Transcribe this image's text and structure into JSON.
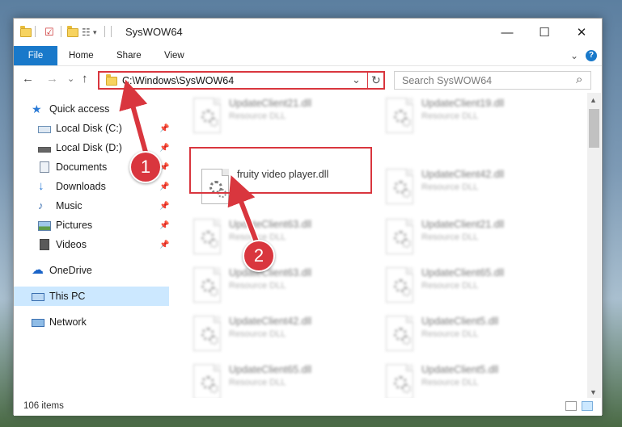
{
  "window": {
    "title": "SysWOW64",
    "controls": {
      "minimize": "—",
      "maximize": "☐",
      "close": "✕"
    }
  },
  "ribbon": {
    "tabs": [
      "File",
      "Home",
      "Share",
      "View"
    ],
    "expand": "⌄",
    "help": "?"
  },
  "nav": {
    "back": "←",
    "forward": "→",
    "recent": "⌄",
    "up": "↑",
    "address": "C:\\Windows\\SysWOW64",
    "dropdown": "⌄",
    "refresh": "↻",
    "search_placeholder": "Search SysWOW64",
    "search_icon": "⌕"
  },
  "sidebar": {
    "items": [
      {
        "label": "Quick access",
        "icon": "star-icon"
      },
      {
        "label": "Local Disk (C:)",
        "icon": "drive-icon"
      },
      {
        "label": "Local Disk (D:)",
        "icon": "drive-icon"
      },
      {
        "label": "Documents",
        "icon": "documents-icon"
      },
      {
        "label": "Downloads",
        "icon": "downloads-icon"
      },
      {
        "label": "Music",
        "icon": "music-icon"
      },
      {
        "label": "Pictures",
        "icon": "pictures-icon"
      },
      {
        "label": "Videos",
        "icon": "videos-icon"
      },
      {
        "label": "OneDrive",
        "icon": "onedrive-icon"
      },
      {
        "label": "This PC",
        "icon": "this-pc-icon"
      },
      {
        "label": "Network",
        "icon": "network-icon"
      }
    ],
    "pin": "📌"
  },
  "files": [
    {
      "name": "UpdateClient21.dll",
      "type": "Resource DLL"
    },
    {
      "name": "UpdateClient19.dll",
      "type": "Resource DLL"
    },
    {
      "name": "fruity video player.dll",
      "type": ""
    },
    {
      "name": "UpdateClient42.dll",
      "type": "Resource DLL"
    },
    {
      "name": "UpdateClient63.dll",
      "type": "Resource DLL"
    },
    {
      "name": "UpdateClient21.dll",
      "type": "Resource DLL"
    },
    {
      "name": "UpdateClient63.dll",
      "type": "Resource DLL"
    },
    {
      "name": "UpdateClient65.dll",
      "type": "Resource DLL"
    },
    {
      "name": "UpdateClient42.dll",
      "type": "Resource DLL"
    },
    {
      "name": "UpdateClient5.dll",
      "type": "Resource DLL"
    },
    {
      "name": "UpdateClient65.dll",
      "type": "Resource DLL"
    },
    {
      "name": "UpdateClient5.dll",
      "type": "Resource DLL"
    }
  ],
  "status": {
    "count": "106 items"
  },
  "callouts": {
    "one": "1",
    "two": "2"
  },
  "colors": {
    "accent": "#1979ca",
    "highlight": "#d9363e",
    "selection": "#cce8ff"
  }
}
